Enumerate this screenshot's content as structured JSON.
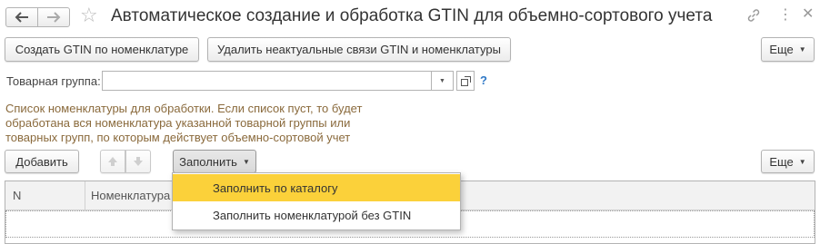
{
  "window": {
    "title": "Автоматическое создание и обработка GTIN для объемно-сортового учета"
  },
  "icons": {
    "back": "arrow-left-icon",
    "forward": "arrow-right-icon",
    "favorite": "star-icon",
    "link": "link-icon",
    "more": "vertical-dots-icon",
    "close": "close-icon",
    "up": "arrow-up-icon",
    "down": "arrow-down-icon",
    "open": "open-form-icon",
    "help": "help-icon"
  },
  "toolbar": {
    "create_gtin_label": "Создать GTIN по номенклатуре",
    "delete_links_label": "Удалить неактуальные связи GTIN и номенклатуры",
    "more_label": "Еще"
  },
  "form": {
    "product_group_label": "Товарная группа:",
    "product_group_value": "",
    "help_text": "?"
  },
  "info": {
    "line1": "Список номенклатуры для обработки. Если список пуст, то будет",
    "line2": "обработана вся номенклатура указанной товарной группы или",
    "line3": "товарных групп, по которым действует объемно-сортовой учет"
  },
  "list_toolbar": {
    "add_label": "Добавить",
    "fill_label": "Заполнить",
    "more_label": "Еще"
  },
  "table": {
    "columns": [
      "N",
      "Номенклатура"
    ]
  },
  "fill_menu": {
    "items": [
      "Заполнить по каталогу",
      "Заполнить номенклатурой без GTIN"
    ]
  },
  "colors": {
    "info_text": "#8a6a3c",
    "menu_highlight": "#fbd13a",
    "help": "#2f78c6"
  }
}
